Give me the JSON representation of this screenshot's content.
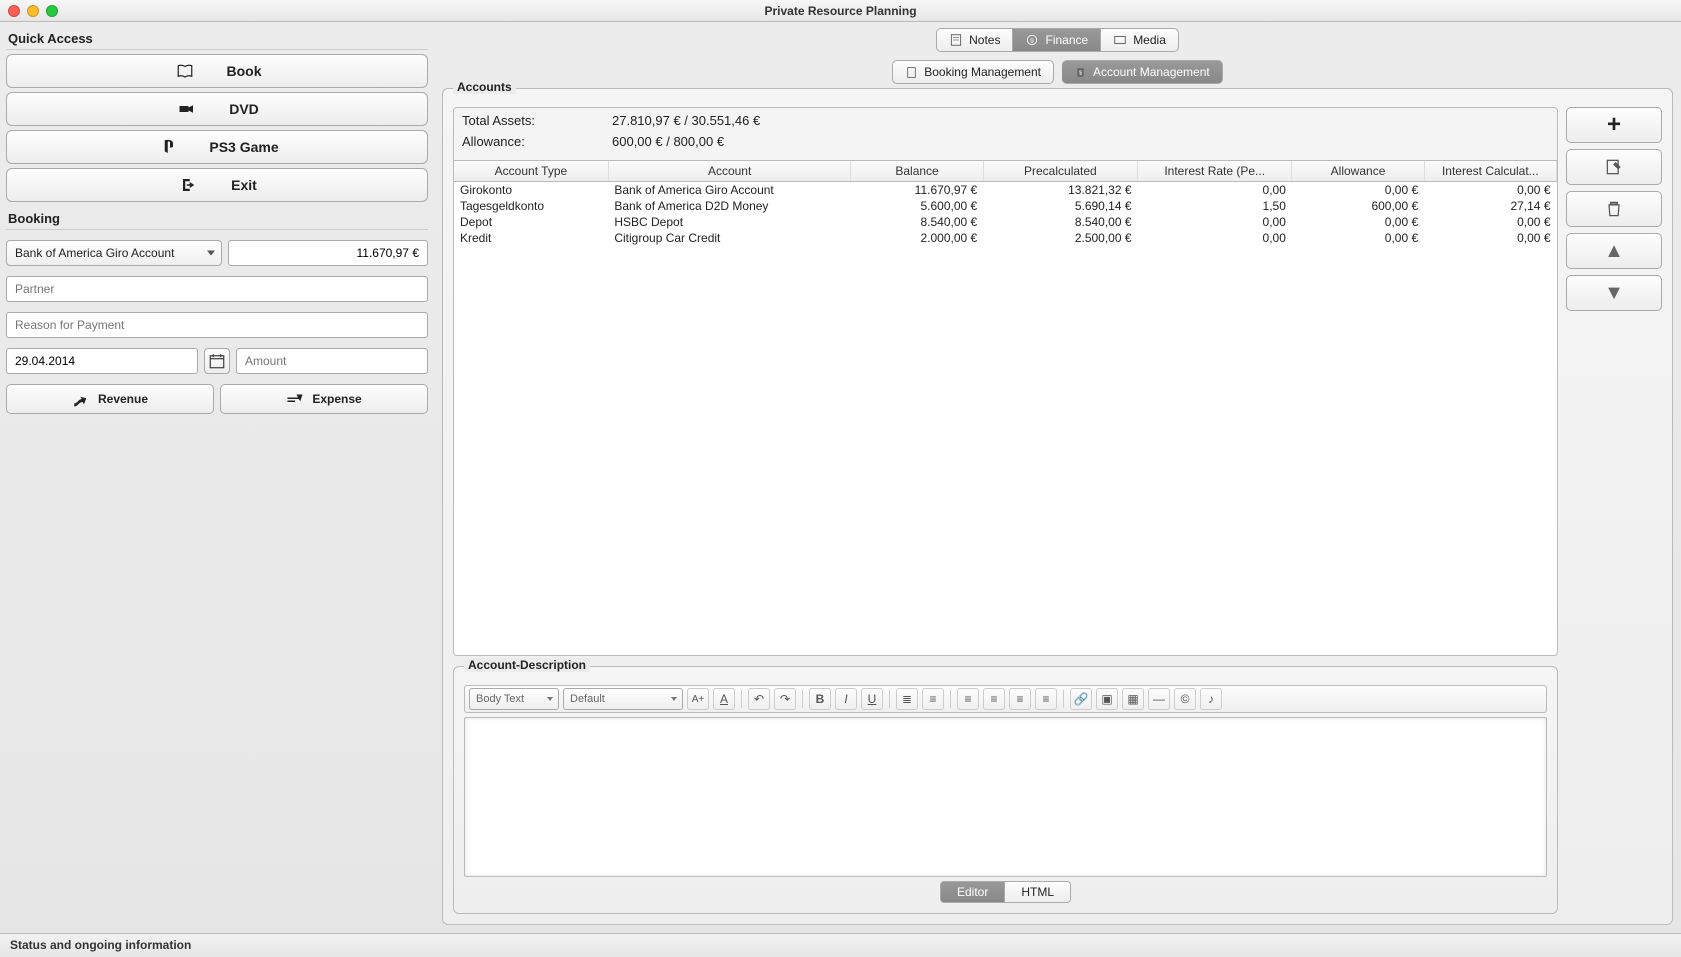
{
  "window": {
    "title": "Private Resource Planning"
  },
  "sidebar": {
    "quick_access_label": "Quick Access",
    "buttons": [
      {
        "label": "Book"
      },
      {
        "label": "DVD"
      },
      {
        "label": "PS3 Game"
      },
      {
        "label": "Exit"
      }
    ],
    "booking_label": "Booking",
    "booking": {
      "account_select": "Bank of America Giro Account",
      "balance": "11.670,97 €",
      "partner_placeholder": "Partner",
      "reason_placeholder": "Reason for Payment",
      "date": "29.04.2014",
      "amount_placeholder": "Amount",
      "revenue_label": "Revenue",
      "expense_label": "Expense"
    }
  },
  "top_tabs": {
    "notes": "Notes",
    "finance": "Finance",
    "media": "Media"
  },
  "sub_tabs": {
    "booking_mgmt": "Booking Management",
    "account_mgmt": "Account Management"
  },
  "accounts": {
    "section_label": "Accounts",
    "total_assets_label": "Total Assets:",
    "total_assets_value": "27.810,97 €  /  30.551,46 €",
    "allowance_label": "Allowance:",
    "allowance_value": "600,00 €  /  800,00 €",
    "headers": [
      "Account Type",
      "Account",
      "Balance",
      "Precalculated",
      "Interest Rate (Pe...",
      "Allowance",
      "Interest Calculat..."
    ],
    "rows": [
      {
        "type": "Girokonto",
        "account": "Bank of America Giro Account",
        "balance": "11.670,97 €",
        "precalc": "13.821,32 €",
        "rate": "0,00",
        "allowance": "0,00 €",
        "intcalc": "0,00 €"
      },
      {
        "type": "Tagesgeldkonto",
        "account": "Bank of America D2D Money",
        "balance": "5.600,00 €",
        "precalc": "5.690,14 €",
        "rate": "1,50",
        "allowance": "600,00 €",
        "intcalc": "27,14 €"
      },
      {
        "type": "Depot",
        "account": "HSBC Depot",
        "balance": "8.540,00 €",
        "precalc": "8.540,00 €",
        "rate": "0,00",
        "allowance": "0,00 €",
        "intcalc": "0,00 €"
      },
      {
        "type": "Kredit",
        "account": "Citigroup Car Credit",
        "balance": "2.000,00 €",
        "precalc": "2.500,00 €",
        "rate": "0,00",
        "allowance": "0,00 €",
        "intcalc": "0,00 €"
      }
    ]
  },
  "description": {
    "section_label": "Account-Description",
    "style_select": "Body Text",
    "font_select": "Default",
    "editor_tab": "Editor",
    "html_tab": "HTML"
  },
  "statusbar": "Status and ongoing information"
}
